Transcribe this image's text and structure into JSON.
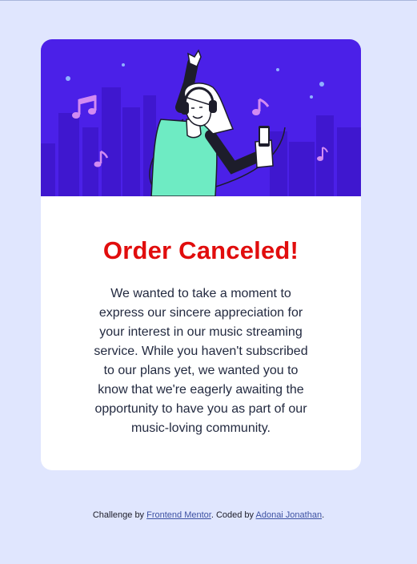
{
  "card": {
    "title": "Order Canceled!",
    "message": "We wanted to take a moment to express our sincere appreciation for your interest in our music streaming service. While you haven't subscribed to our plans yet, we wanted you to know that we're eagerly awaiting the opportunity to have you as part of our music-loving community.",
    "illustration": "woman-listening-to-music-illustration"
  },
  "footer": {
    "prefix": "Challenge by ",
    "link1": "Frontend Mentor",
    "middle": ". Coded by ",
    "link2": "Adonai Jonathan",
    "suffix": "."
  },
  "colors": {
    "background": "#e0e6fe",
    "hero": "#4b20e8",
    "title": "#e10d0d",
    "link": "#3e52a3"
  }
}
